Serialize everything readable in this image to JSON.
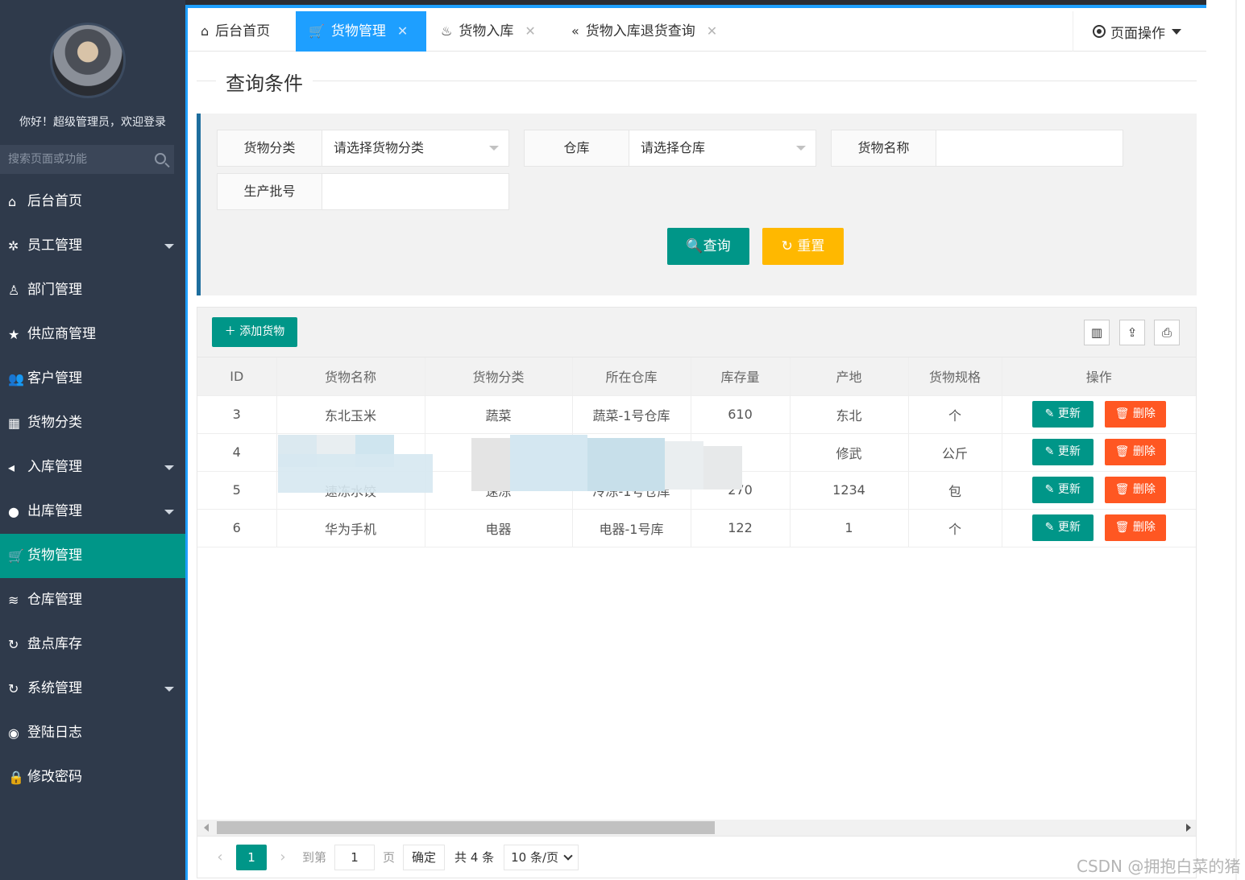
{
  "sidebar": {
    "welcome": "你好！超级管理员，欢迎登录",
    "search_placeholder": "搜索页面或功能",
    "items": [
      {
        "label": "后台首页",
        "icon": "home-icon"
      },
      {
        "label": "员工管理",
        "icon": "gear-icon"
      },
      {
        "label": "部门管理",
        "icon": "user-outline-icon"
      },
      {
        "label": "供应商管理",
        "icon": "star-icon"
      },
      {
        "label": "客户管理",
        "icon": "users-icon"
      },
      {
        "label": "货物分类",
        "icon": "grid-icon"
      },
      {
        "label": "入库管理",
        "icon": "speaker-icon"
      },
      {
        "label": "出库管理",
        "icon": "chat-icon"
      },
      {
        "label": "货物管理",
        "icon": "cart-icon"
      },
      {
        "label": "仓库管理",
        "icon": "layers-icon"
      },
      {
        "label": "盘点库存",
        "icon": "refresh-icon"
      },
      {
        "label": "系统管理",
        "icon": "refresh-icon"
      },
      {
        "label": "登陆日志",
        "icon": "weibo-icon"
      },
      {
        "label": "修改密码",
        "icon": "lock-icon"
      }
    ]
  },
  "tabs": [
    {
      "label": "后台首页",
      "icon": "home-icon"
    },
    {
      "label": "货物管理",
      "icon": "cart-icon"
    },
    {
      "label": "货物入库",
      "icon": "fire-icon"
    },
    {
      "label": "货物入库退货查询",
      "icon": "double-left-icon"
    }
  ],
  "page_ops": "页面操作",
  "query": {
    "title": "查询条件",
    "category_label": "货物分类",
    "category_value": "请选择货物分类",
    "warehouse_label": "仓库",
    "warehouse_value": "请选择仓库",
    "name_label": "货物名称",
    "batch_label": "生产批号",
    "search_btn": "查询",
    "reset_btn": "重置"
  },
  "toolbar": {
    "add_btn": "添加货物"
  },
  "table": {
    "headers": [
      "ID",
      "货物名称",
      "货物分类",
      "所在仓库",
      "库存量",
      "产地",
      "货物规格",
      "操作"
    ],
    "rows": [
      [
        "3",
        "东北玉米",
        "蔬菜",
        "蔬菜-1号仓库",
        "610",
        "东北",
        "个"
      ],
      [
        "4",
        "",
        "",
        "",
        "",
        "修武",
        "公斤"
      ],
      [
        "5",
        "速冻水饺",
        "速冻",
        "冷冻-1号仓库",
        "270",
        "1234",
        "包"
      ],
      [
        "6",
        "华为手机",
        "电器",
        "电器-1号库",
        "122",
        "1",
        "个"
      ]
    ],
    "edit_label": "更新",
    "delete_label": "删除"
  },
  "pager": {
    "current": "1",
    "goto_label": "到第",
    "goto_value": "1",
    "page_unit": "页",
    "confirm": "确定",
    "total": "共 4 条",
    "per_page": "10 条/页"
  },
  "watermark": "CSDN @拥抱白菜的猪"
}
